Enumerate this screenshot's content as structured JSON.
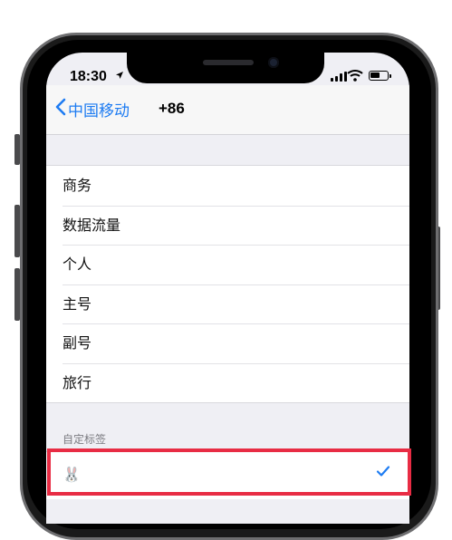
{
  "status_bar": {
    "time": "18:30",
    "location_icon": "location-arrow-icon",
    "signal_icon": "cell-signal-icon",
    "wifi_icon": "wifi-icon",
    "battery_icon": "battery-icon"
  },
  "nav": {
    "back_label": "中国移动",
    "title": "+86"
  },
  "labels": {
    "items": [
      {
        "label": "商务"
      },
      {
        "label": "数据流量"
      },
      {
        "label": "个人"
      },
      {
        "label": "主号"
      },
      {
        "label": "副号"
      },
      {
        "label": "旅行"
      }
    ]
  },
  "custom": {
    "section_title": "自定标签",
    "value": "🐰",
    "selected": true
  },
  "colors": {
    "accent": "#1e7cf2",
    "highlight": "#e82c44",
    "background": "#efeff4"
  }
}
